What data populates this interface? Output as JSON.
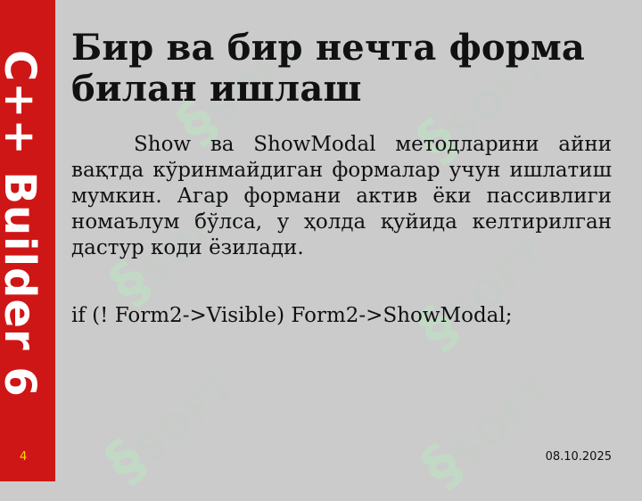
{
  "sidebar": {
    "brand_text": "C++ Builder 6",
    "color": "#cf1616"
  },
  "watermark_text": "SOFT",
  "slide": {
    "title": "Бир ва бир нечта форма билан ишлаш",
    "paragraph": "Show ва ShowModal методларини айни вақтда кўринмайдиган формалар учун ишлатиш мумкин. Агар формани актив ёки пассивлиги номаълум бўлса, у ҳолда қуйида келтирилган дастур коди ёзилади.",
    "code_line": "if (! Form2->Visible) Form2->ShowModal;"
  },
  "footer": {
    "slide_number": "4",
    "date": "08.10.2025"
  }
}
